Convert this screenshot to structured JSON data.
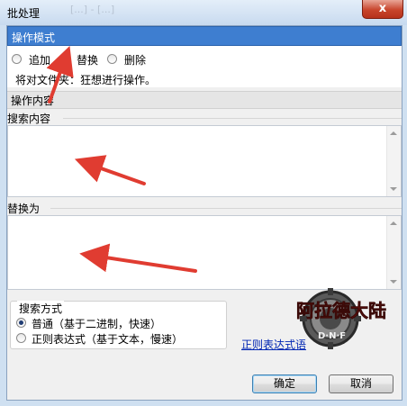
{
  "window": {
    "title": "批处理",
    "ghost_title": "[...] - [...]",
    "close_glyph": "x"
  },
  "mode": {
    "header": "操作模式",
    "options": [
      {
        "label": "追加",
        "checked": false
      },
      {
        "label": "替换",
        "checked": true
      },
      {
        "label": "删除",
        "checked": false
      }
    ],
    "file_notice": "将对文件夹：狂想进行操作。"
  },
  "content": {
    "header": "操作内容",
    "search_label": "搜索内容",
    "search_value": "",
    "replace_label": "替换为",
    "replace_value": ""
  },
  "search_method": {
    "label": "搜索方式",
    "options": [
      {
        "label": "普通（基于二进制，快速）",
        "checked": true
      },
      {
        "label": "正则表达式（基于文本，慢速）",
        "checked": false
      }
    ],
    "help_link": "正则表达式语"
  },
  "logo": {
    "text": "阿拉德大陆",
    "sub": "D·N·F"
  },
  "buttons": {
    "ok": "确定",
    "cancel": "取消"
  },
  "colors": {
    "header_bg": "#3e7ed0",
    "arrow": "#e03c31",
    "link": "#0026b3"
  }
}
